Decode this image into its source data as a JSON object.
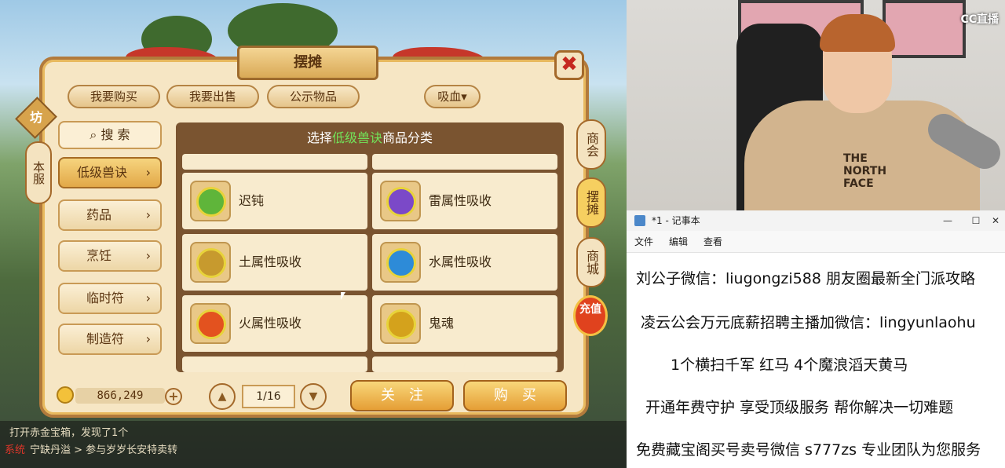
{
  "game": {
    "window_title": "摆摊",
    "close_symbol": "✖",
    "top_tabs": [
      "我要购买",
      "我要出售",
      "公示物品",
      "吸血▾"
    ],
    "side_tag": "坊",
    "side_server": "本服",
    "search_label": "搜 索",
    "categories": [
      {
        "label": "低级兽诀",
        "active": true
      },
      {
        "label": "药品",
        "active": false
      },
      {
        "label": "烹饪",
        "active": false
      },
      {
        "label": "临时符",
        "active": false
      },
      {
        "label": "制造符",
        "active": false
      }
    ],
    "chevron": "›",
    "list_heading_pre": "选择",
    "list_heading_highlight": "低级兽诀",
    "list_heading_post": "商品分类",
    "items": [
      {
        "name": "迟钝",
        "icon": "slow-skill-icon",
        "color": "#5fb53a"
      },
      {
        "name": "雷属性吸收",
        "icon": "thunder-absorb-icon",
        "color": "#7b49c8"
      },
      {
        "name": "土属性吸收",
        "icon": "earth-absorb-icon",
        "color": "#c79a2e"
      },
      {
        "name": "水属性吸收",
        "icon": "water-absorb-icon",
        "color": "#2d8bd8"
      },
      {
        "name": "火属性吸收",
        "icon": "fire-absorb-icon",
        "color": "#e3521f"
      },
      {
        "name": "鬼魂",
        "icon": "ghost-skill-icon",
        "color": "#d4a21c"
      }
    ],
    "right_tabs": [
      {
        "label": "商会",
        "active": false
      },
      {
        "label": "摆摊",
        "active": true
      },
      {
        "label": "商城",
        "active": false
      }
    ],
    "recharge_label": "充值",
    "money": "866,249",
    "plus": "+",
    "page_prev": "▲",
    "page_next": "▼",
    "page": "1/16",
    "follow_button": "关注",
    "buy_button": "购买",
    "chat": [
      {
        "tag": "",
        "text": "打开赤金宝箱，发现了1个"
      },
      {
        "tag": "系统",
        "text": "宁缺丹溢 > 参与岁岁长安特卖转"
      }
    ]
  },
  "stream": {
    "logo": "CC直播",
    "hoodie_text": [
      "THE",
      "NORTH",
      "FACE"
    ]
  },
  "notepad": {
    "title": "*1 - 记事本",
    "window_buttons": [
      "—",
      "☐",
      "✕"
    ],
    "menu": [
      "文件",
      "编辑",
      "查看"
    ],
    "lines": [
      "刘公子微信：liugongzi588 朋友圈最新全门派攻略",
      "凌云公会万元底薪招聘主播加微信：lingyunlaohu",
      "1个横扫千军 红马    4个魔浪滔天黄马",
      "开通年费守护 享受顶级服务 帮你解决一切难题",
      "免费藏宝阁买号卖号微信 s777zs 专业团队为您服务"
    ]
  }
}
